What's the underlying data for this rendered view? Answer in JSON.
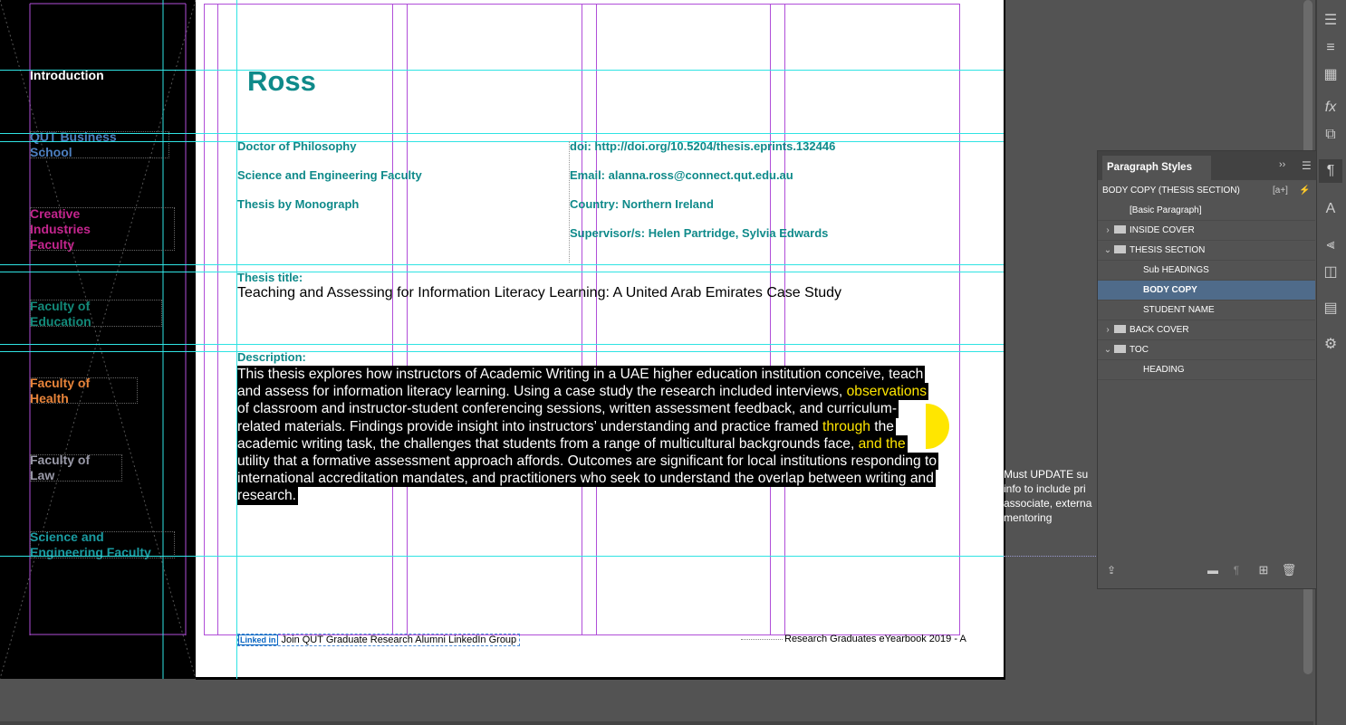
{
  "left_sections": [
    {
      "label": "Introduction",
      "color": "#ffffff"
    },
    {
      "label": "QUT Business School",
      "color": "#4d7fbf"
    },
    {
      "label": "Creative Industries Faculty",
      "color": "#c4258e"
    },
    {
      "label": "Faculty of Education",
      "color": "#138a7a"
    },
    {
      "label": "Faculty of Health",
      "color": "#e8843a"
    },
    {
      "label": "Faculty of Law",
      "color": "#9a9aa8"
    },
    {
      "label": "Science and Engineering Faculty",
      "color": "#1a9aa0"
    }
  ],
  "student": {
    "name": "Ross"
  },
  "meta_left": [
    "Doctor of Philosophy",
    "Science and Engineering Faculty",
    "Thesis by Monograph"
  ],
  "meta_right": [
    "doi: http://doi.org/10.5204/thesis.eprints.132446",
    "Email: alanna.ross@connect.qut.edu.au",
    "Country: Northern Ireland",
    "Supervisor/s: Helen Partridge, Sylvia Edwards"
  ],
  "thesis": {
    "title_label": "Thesis title:",
    "title": "Teaching and Assessing for Information Literacy Learning: A United Arab Emirates Case Study",
    "description_label": "Description:",
    "description_lines": [
      "This thesis explores how instructors of Academic Writing in a UAE higher education institution conceive, teach",
      "and assess for information literacy learning. Using a case study the research included interviews, observations",
      "of classroom and instructor-student conferencing sessions, written assessment feedback, and curriculum-",
      "related materials.  Findings provide insight into instructors’ understanding and practice framed through the",
      "academic writing task, the challenges that students from a range of multicultural backgrounds face, and the",
      "utility that a formative assessment approach affords.  Outcomes are significant for local institutions responding to",
      "international accreditation mandates, and practitioners who seek to understand the overlap between writing and",
      "research."
    ]
  },
  "footer": {
    "linkedin_badge": "Linked in",
    "left": "Join QUT Graduate Research Alumni LinkedIn Group",
    "right": "Research Graduates eYearbook 2019 - A"
  },
  "note": {
    "lines": [
      "Must UPDATE su",
      "info to include pri",
      "associate, externa",
      "mentoring"
    ]
  },
  "paragraph_styles_panel": {
    "title": "Paragraph Styles",
    "current_style": "BODY COPY (THESIS SECTION)",
    "items": [
      {
        "label": "[Basic Paragraph]",
        "kind": "style",
        "level": 1
      },
      {
        "label": "INSIDE COVER",
        "kind": "folder",
        "level": 0,
        "expanded": false
      },
      {
        "label": "THESIS SECTION",
        "kind": "folder",
        "level": 0,
        "expanded": true
      },
      {
        "label": "Sub HEADINGS",
        "kind": "style",
        "level": 2
      },
      {
        "label": "BODY COPY",
        "kind": "style",
        "level": 2,
        "selected": true
      },
      {
        "label": "STUDENT NAME",
        "kind": "style",
        "level": 2
      },
      {
        "label": "BACK COVER",
        "kind": "folder",
        "level": 0,
        "expanded": false
      },
      {
        "label": "TOC",
        "kind": "folder",
        "level": 0,
        "expanded": true
      },
      {
        "label": "HEADING",
        "kind": "style",
        "level": 2
      }
    ],
    "new_style_label": "[a+]"
  },
  "toolbar_icons": [
    "menu-icon",
    "stroke-icon",
    "swatches-icon",
    "pages-icon",
    "effects-icon",
    "links-icon",
    "paragraph-styles-icon",
    "character-styles-icon",
    "align-icon",
    "pathfinder-icon",
    "text-wrap-icon",
    "scripts-icon"
  ],
  "colors": {
    "accent_teal": "#0f8a8a",
    "guide_cyan": "#2fe3e3",
    "margin_purple": "#b04ed8",
    "highlight_yellow": "#ffe600",
    "selected_row": "#4f6b8a"
  }
}
